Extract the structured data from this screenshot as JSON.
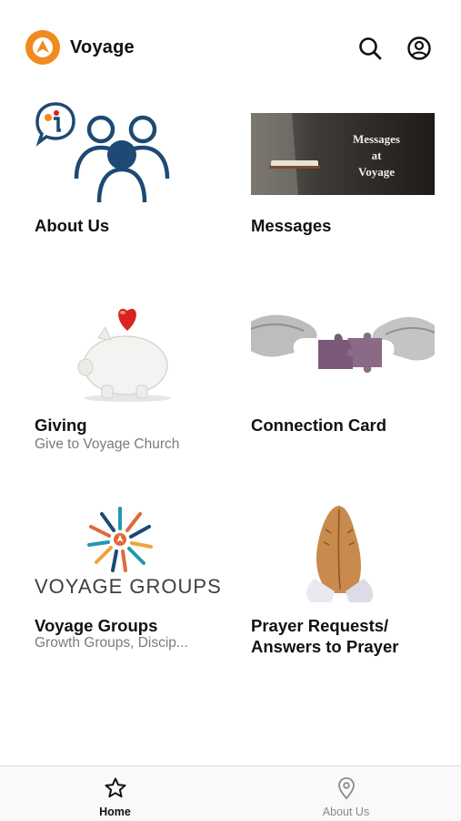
{
  "app": {
    "title": "Voyage"
  },
  "header": {
    "search_icon": "search-icon",
    "account_icon": "account-icon"
  },
  "colors": {
    "brand_orange": "#f28a1e",
    "primary_blue": "#1c4a74",
    "heart_red": "#d8231e",
    "tab_active": "#111111",
    "tab_inactive": "#8a8a8a"
  },
  "tiles": [
    {
      "title": "About Us",
      "subtitle": "",
      "image": "about-us-people-info"
    },
    {
      "title": "Messages",
      "subtitle": "",
      "image": "messages-banner",
      "image_text": [
        "Messages",
        "at",
        "Voyage"
      ]
    },
    {
      "title": "Giving",
      "subtitle": "Give to Voyage Church",
      "image": "piggy-bank-heart"
    },
    {
      "title": "Connection Card",
      "subtitle": "",
      "image": "puzzle-hands"
    },
    {
      "title": "Voyage Groups",
      "subtitle": "Growth Groups, Discip...",
      "image": "voyage-groups-logo",
      "image_text": "VOYAGE GROUPS"
    },
    {
      "title": "Prayer Requests/",
      "title_line2": "Answers to Prayer",
      "subtitle": "",
      "image": "praying-hands"
    }
  ],
  "tabbar": {
    "items": [
      {
        "label": "Home",
        "icon": "star-icon",
        "active": true
      },
      {
        "label": "About Us",
        "icon": "location-pin-icon",
        "active": false
      }
    ]
  }
}
